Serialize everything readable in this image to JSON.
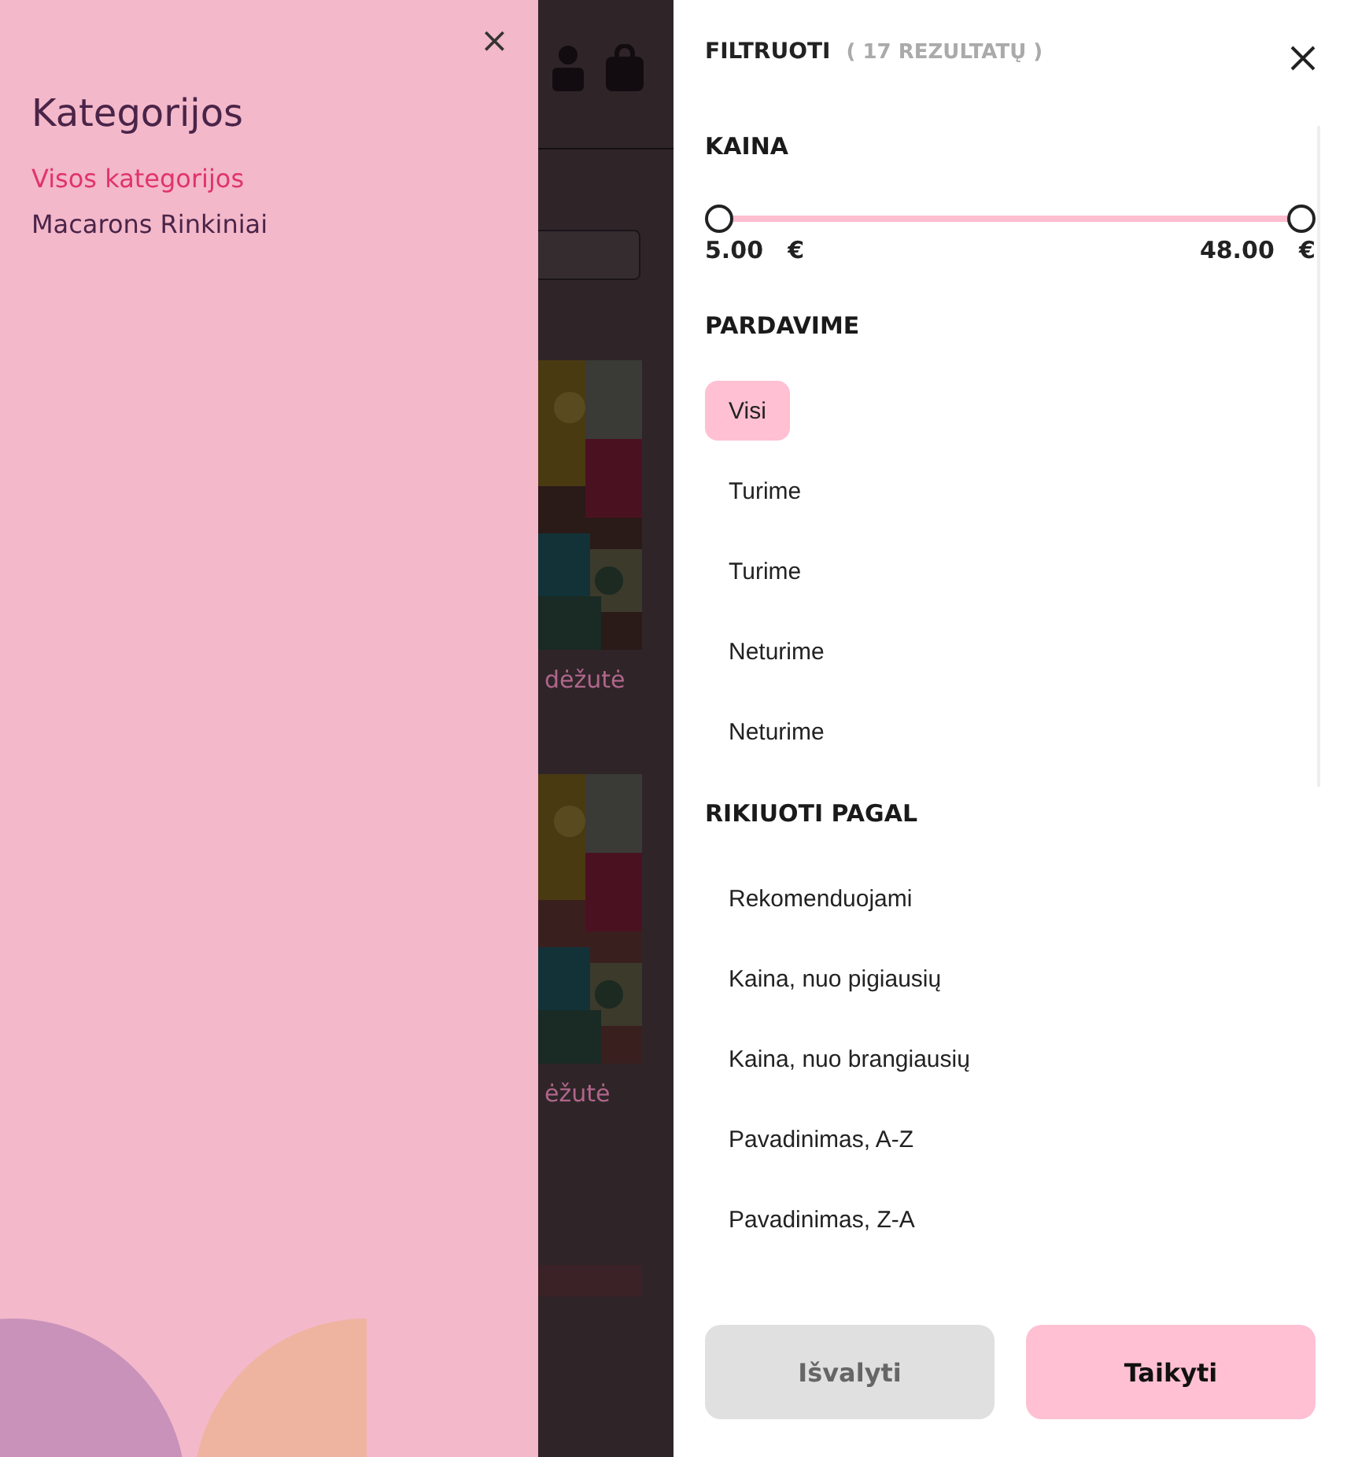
{
  "category_drawer": {
    "title": "Kategorijos",
    "close": "×",
    "items": [
      {
        "label": "Visos kategorijos",
        "selected": true
      },
      {
        "label": "Macarons Rinkiniai",
        "selected": false
      }
    ]
  },
  "background_page": {
    "products": [
      {
        "name": "dėžutė"
      },
      {
        "name": "ėžutė"
      }
    ]
  },
  "filter_panel": {
    "title": "FILTRUOTI",
    "result_count": "( 17 REZULTATŲ )",
    "price": {
      "heading": "KAINA",
      "thumbs": [
        {
          "level": 0
        },
        {
          "level": 1
        }
      ],
      "min": "5.00",
      "max": "48.00",
      "currency": "€"
    },
    "availability": {
      "heading": "PARDAVIME",
      "options": [
        {
          "label": "Visi",
          "selected": true
        },
        {
          "label": "Turime",
          "selected": false
        },
        {
          "label": "Turime",
          "selected": false
        },
        {
          "label": "Neturime",
          "selected": false
        },
        {
          "label": "Neturime",
          "selected": false
        }
      ]
    },
    "sort": {
      "heading": "RIKIUOTI PAGAL",
      "options": [
        {
          "label": "Rekomenduojami",
          "selected": false
        },
        {
          "label": "Kaina, nuo pigiausių",
          "selected": false
        },
        {
          "label": "Kaina, nuo brangiausių",
          "selected": false
        },
        {
          "label": "Pavadinimas, A-Z",
          "selected": false
        },
        {
          "label": "Pavadinimas, Z-A",
          "selected": false
        }
      ]
    },
    "buttons": [
      {
        "label": "Išvalyti",
        "kind": "secondary"
      },
      {
        "label": "Taikyti",
        "kind": "primary"
      }
    ]
  }
}
